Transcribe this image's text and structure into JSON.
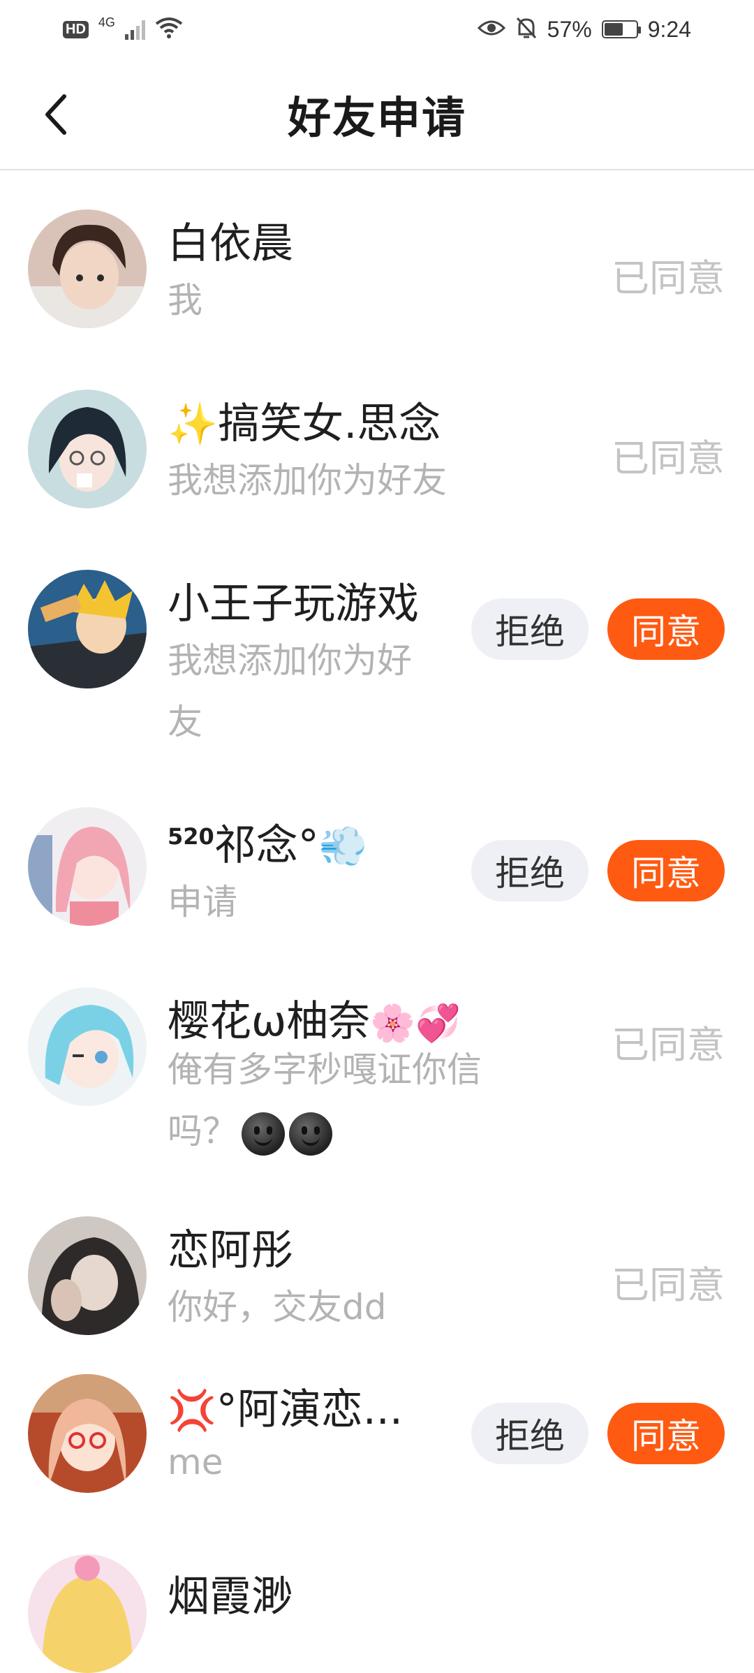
{
  "status_bar": {
    "hd": "HD",
    "network": "4G",
    "battery_percent": "57%",
    "time": "9:24"
  },
  "header": {
    "title": "好友申请"
  },
  "actions": {
    "reject_label": "拒绝",
    "accept_label": "同意",
    "accepted_label": "已同意"
  },
  "requests": [
    {
      "name": "白依晨",
      "message": "我",
      "state": "accepted"
    },
    {
      "name": "搞笑女.思念",
      "name_prefix_emoji": "✨",
      "message": "我想添加你为好友",
      "state": "accepted"
    },
    {
      "name": "小王子玩游戏",
      "message_line1": "我想添加你为好",
      "message_line2": "友",
      "state": "pending"
    },
    {
      "name_sup": "520",
      "name": "祁念°",
      "name_suffix_emoji": "💨",
      "message": "申请",
      "state": "pending"
    },
    {
      "name": "樱花ω柚奈",
      "name_suffix_emoji": "🌸💞",
      "message_line1": "俺有多字秒嘎证你信",
      "message_line2": "吗？",
      "state": "accepted"
    },
    {
      "name": "恋阿彤",
      "message": "你好，交友dd",
      "state": "accepted"
    },
    {
      "name_prefix_emoji": "💢",
      "name": "°阿演恋...",
      "message": "me",
      "state": "pending"
    },
    {
      "name": "烟霞渺",
      "state": "accepted"
    }
  ],
  "colors": {
    "accent": "#ff5a12",
    "reject_bg": "#eef0f5",
    "muted_text": "#b3b3b3",
    "accepted_text": "#c4c4c4"
  }
}
